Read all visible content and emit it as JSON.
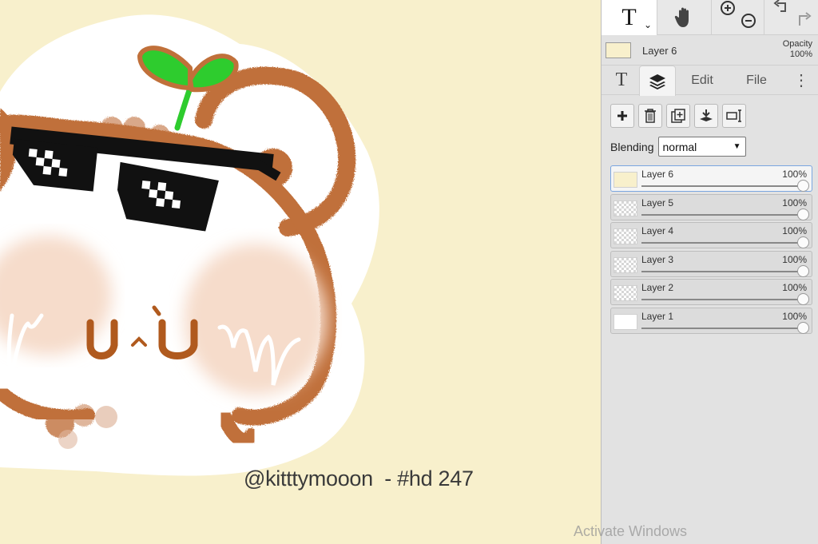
{
  "canvas": {
    "watermark": "@kitttymooon  - #hd 247",
    "background_color": "#f8f0cc",
    "face_text": "U^U"
  },
  "system": {
    "activate_windows": "Activate Windows"
  },
  "toolbar": {
    "text_tool_glyph": "T",
    "text_tool_chevron": "⌄",
    "hand_icon": "hand-icon",
    "zoom_icons": [
      "zoom-in-icon",
      "zoom-out-icon"
    ],
    "history_icons": [
      "undo-icon",
      "redo-icon"
    ]
  },
  "current_layer": {
    "name": "Layer 6",
    "opacity_label": "Opacity",
    "opacity_value": "100%"
  },
  "tabs": {
    "text_glyph": "T",
    "layers_icon": "layers-icon",
    "edit": "Edit",
    "file": "File",
    "more": "⋮"
  },
  "layer_actions": [
    "add-layer-icon",
    "delete-layer-icon",
    "duplicate-layer-icon",
    "merge-down-icon",
    "layer-properties-icon"
  ],
  "blending": {
    "label": "Blending",
    "value": "normal"
  },
  "layers": [
    {
      "name": "Layer 6",
      "opacity": "100%",
      "level": 1.0,
      "active": true,
      "thumb": "cream"
    },
    {
      "name": "Layer 5",
      "opacity": "100%",
      "level": 1.0,
      "active": false,
      "thumb": "check"
    },
    {
      "name": "Layer 4",
      "opacity": "100%",
      "level": 1.0,
      "active": false,
      "thumb": "check"
    },
    {
      "name": "Layer 3",
      "opacity": "100%",
      "level": 1.0,
      "active": false,
      "thumb": "check"
    },
    {
      "name": "Layer 2",
      "opacity": "100%",
      "level": 1.0,
      "active": false,
      "thumb": "check"
    },
    {
      "name": "Layer 1",
      "opacity": "100%",
      "level": 1.0,
      "active": false,
      "thumb": "white"
    }
  ],
  "colors": {
    "brown": "#c0703a",
    "dark_brown": "#b05a1e",
    "sprout_green": "#2ecc2e",
    "blush": "#f6dccb",
    "panel_bg": "#e2e2e2",
    "active_border": "#7aa6e0"
  }
}
